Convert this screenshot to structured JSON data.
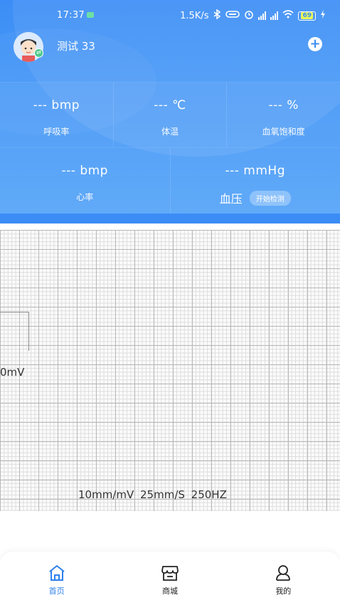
{
  "status_bar": {
    "time": "17:37",
    "speed": "1.5K/s",
    "battery": "69"
  },
  "profile": {
    "name": "测试 33"
  },
  "vitals": {
    "respiration": {
      "value": "--- bmp",
      "label": "呼吸率"
    },
    "temperature": {
      "value": "--- ℃",
      "label": "体温"
    },
    "spo2": {
      "value": "--- %",
      "label": "血氧饱和度"
    },
    "heart_rate": {
      "value": "--- bmp",
      "label": "心率"
    },
    "blood_pressure": {
      "value": "--- mmHg",
      "label": "血压",
      "action": "开始检测"
    }
  },
  "ecg": {
    "calibration_label": "0mV",
    "params": "10mm/mV 25mm/S 250HZ"
  },
  "nav": {
    "items": [
      {
        "label": "首页",
        "icon": "home-icon",
        "active": true
      },
      {
        "label": "商城",
        "icon": "store-icon",
        "active": false
      },
      {
        "label": "我的",
        "icon": "user-icon",
        "active": false
      }
    ]
  },
  "colors": {
    "primary": "#3c8ef6",
    "active_nav": "#2f80ed"
  }
}
